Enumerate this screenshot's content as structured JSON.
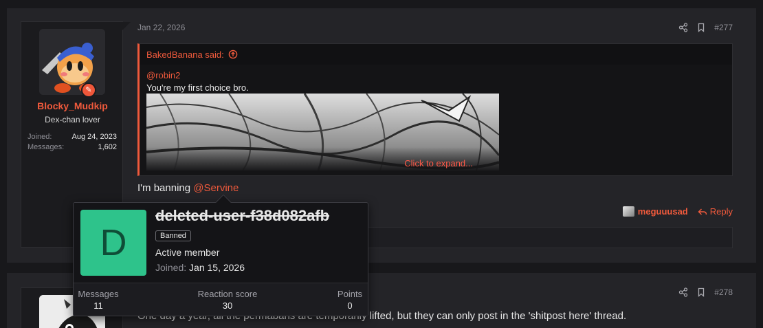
{
  "post1": {
    "user": {
      "name": "Blocky_Mudkip",
      "title": "Dex-chan lover",
      "stats": [
        {
          "label": "Joined:",
          "value": "Aug 24, 2023"
        },
        {
          "label": "Messages:",
          "value": "1,602"
        }
      ]
    },
    "date": "Jan 22, 2026",
    "number": "#277",
    "quote": {
      "author_said": "BakedBanana said:",
      "mention": "@robin2",
      "text": "You're my first choice bro.",
      "expand": "Click to expand..."
    },
    "body_prefix": "I'm banning ",
    "body_mention": "@Servine",
    "reactor": "meguuusad",
    "reply_label": "Reply"
  },
  "post2": {
    "number": "#278",
    "text": "One day a year, all the permabans are temporarily lifted, but they can only post in the 'shitpost here' thread."
  },
  "popup": {
    "avatar_letter": "D",
    "name": "deleted-user-f38d082afb",
    "badge": "Banned",
    "title": "Active member",
    "joined_label": "Joined:",
    "joined_value": "Jan 15, 2026",
    "stats": [
      {
        "label": "Messages",
        "value": "11"
      },
      {
        "label": "Reaction score",
        "value": "30"
      },
      {
        "label": "Points",
        "value": "0"
      }
    ]
  },
  "colors": {
    "accent": "#f05a3c",
    "popup_avatar_bg": "#2ec38b",
    "background": "#18181b",
    "card": "#242428"
  }
}
